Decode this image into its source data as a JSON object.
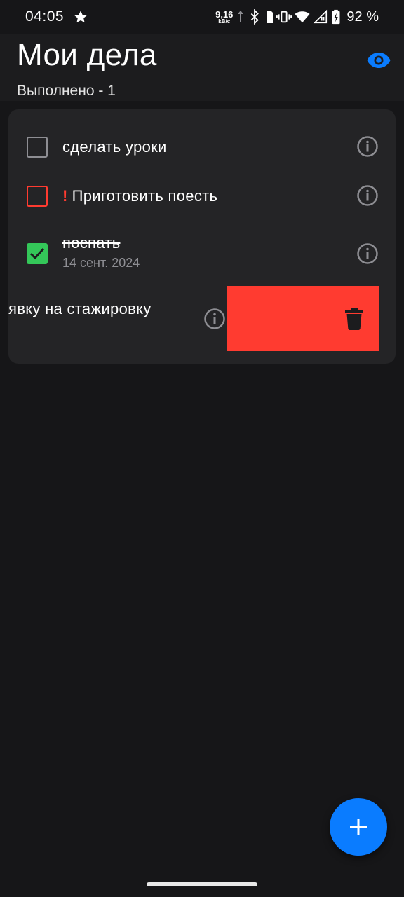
{
  "status_bar": {
    "time": "04:05",
    "net_speed_value": "9,16",
    "net_speed_unit": "kB/c",
    "battery_percent": "92 %",
    "icons": [
      "star-icon",
      "upload-arrow-icon",
      "bluetooth-icon",
      "sim-icon",
      "vibrate-icon",
      "wifi-icon",
      "signal-icon",
      "battery-charging-icon"
    ]
  },
  "header": {
    "title": "Мои дела",
    "subtitle": "Выполнено - 1",
    "visibility_icon": "eye-icon",
    "accent_color": "#0a7cff"
  },
  "tasks": [
    {
      "text": "сделать уроки",
      "state": "unchecked",
      "important": false
    },
    {
      "text": "Приготовить поесть",
      "important_mark": "!",
      "state": "unchecked",
      "important": true
    },
    {
      "text": "поспать",
      "date": "14 сент. 2024",
      "state": "checked"
    },
    {
      "text": "явку на стажировку",
      "state": "swiped",
      "action_icon": "trash-icon"
    }
  ],
  "colors": {
    "background": "#161618",
    "card": "#242426",
    "delete": "#ff3b30",
    "checked": "#34c759",
    "important": "#ff3b30",
    "fab": "#0a7cff"
  },
  "fab": {
    "icon": "plus-icon"
  }
}
